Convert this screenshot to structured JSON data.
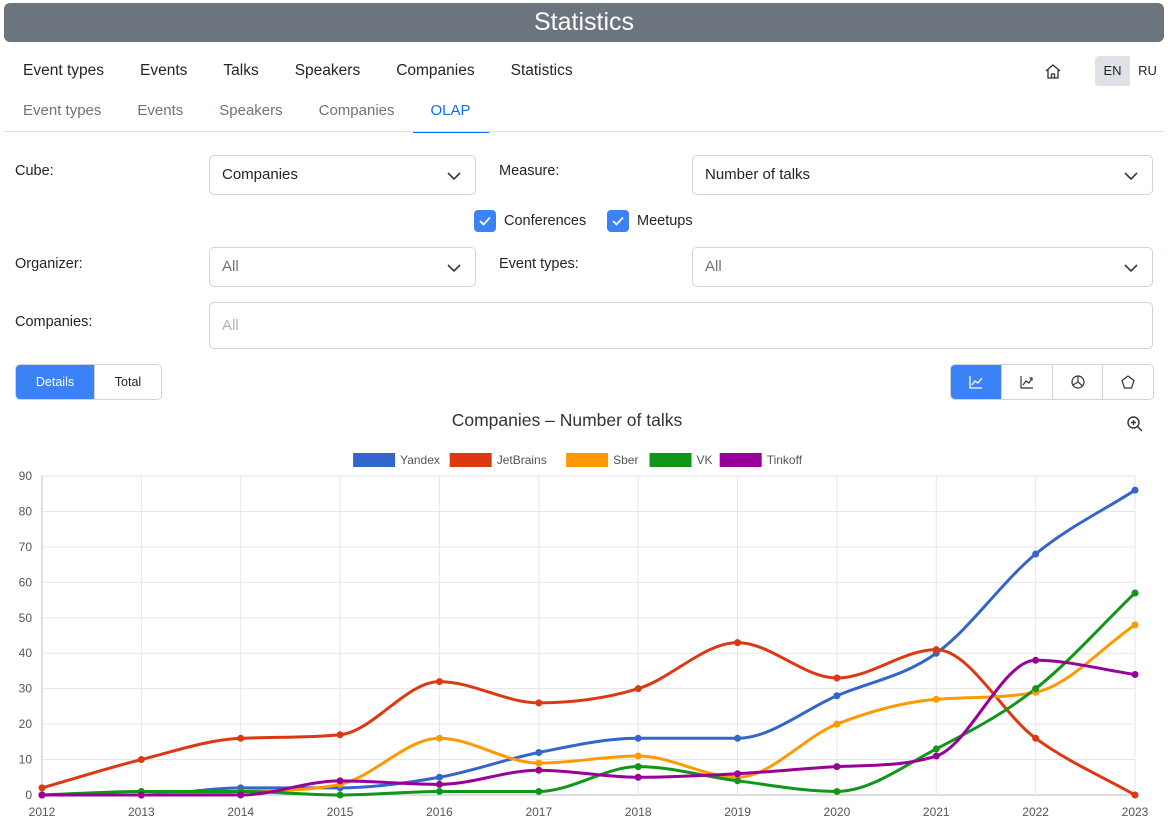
{
  "header": {
    "title": "Statistics"
  },
  "nav_main": [
    "Event types",
    "Events",
    "Talks",
    "Speakers",
    "Companies",
    "Statistics"
  ],
  "nav_sub": [
    "Event types",
    "Events",
    "Speakers",
    "Companies",
    "OLAP"
  ],
  "nav_sub_active": "OLAP",
  "language": {
    "options": [
      "EN",
      "RU"
    ],
    "selected": "EN"
  },
  "filters": {
    "cube_label": "Cube:",
    "cube_value": "Companies",
    "measure_label": "Measure:",
    "measure_value": "Number of talks",
    "conferences_label": "Conferences",
    "meetups_label": "Meetups",
    "organizer_label": "Organizer:",
    "organizer_value": "All",
    "event_types_label": "Event types:",
    "event_types_value": "All",
    "companies_label": "Companies:",
    "companies_placeholder": "All"
  },
  "view_toggle": {
    "details": "Details",
    "total": "Total",
    "selected": "Details"
  },
  "chart_types": {
    "icons": [
      "line-chart-icon",
      "area-chart-icon",
      "pie-chart-icon",
      "radar-chart-icon"
    ],
    "selected": "line-chart-icon"
  },
  "colors": {
    "accent": "#3b82f6",
    "header_bg": "#6c757d"
  },
  "chart_data": {
    "type": "line",
    "title": "Companies – Number of talks",
    "x": [
      "2012",
      "2013",
      "2014",
      "2015",
      "2016",
      "2017",
      "2018",
      "2019",
      "2020",
      "2021",
      "2022",
      "2023"
    ],
    "ylim": [
      0,
      90
    ],
    "yticks": [
      0,
      10,
      20,
      30,
      40,
      50,
      60,
      70,
      80,
      90
    ],
    "grid": true,
    "legend": "top",
    "series": [
      {
        "name": "Yandex",
        "color": "#3366cc",
        "values": [
          0,
          0,
          2,
          2,
          5,
          12,
          16,
          16,
          28,
          40,
          68,
          86
        ]
      },
      {
        "name": "JetBrains",
        "color": "#dc3912",
        "values": [
          2,
          10,
          16,
          17,
          32,
          26,
          30,
          43,
          33,
          41,
          16,
          0
        ]
      },
      {
        "name": "Sber",
        "color": "#ff9900",
        "values": [
          0,
          0,
          1,
          3,
          16,
          9,
          11,
          5,
          20,
          27,
          29,
          48
        ]
      },
      {
        "name": "VK",
        "color": "#109618",
        "values": [
          0,
          1,
          1,
          0,
          1,
          1,
          8,
          4,
          1,
          13,
          30,
          57
        ]
      },
      {
        "name": "Tinkoff",
        "color": "#990099",
        "values": [
          0,
          0,
          0,
          4,
          3,
          7,
          5,
          6,
          8,
          11,
          38,
          34
        ]
      }
    ]
  }
}
